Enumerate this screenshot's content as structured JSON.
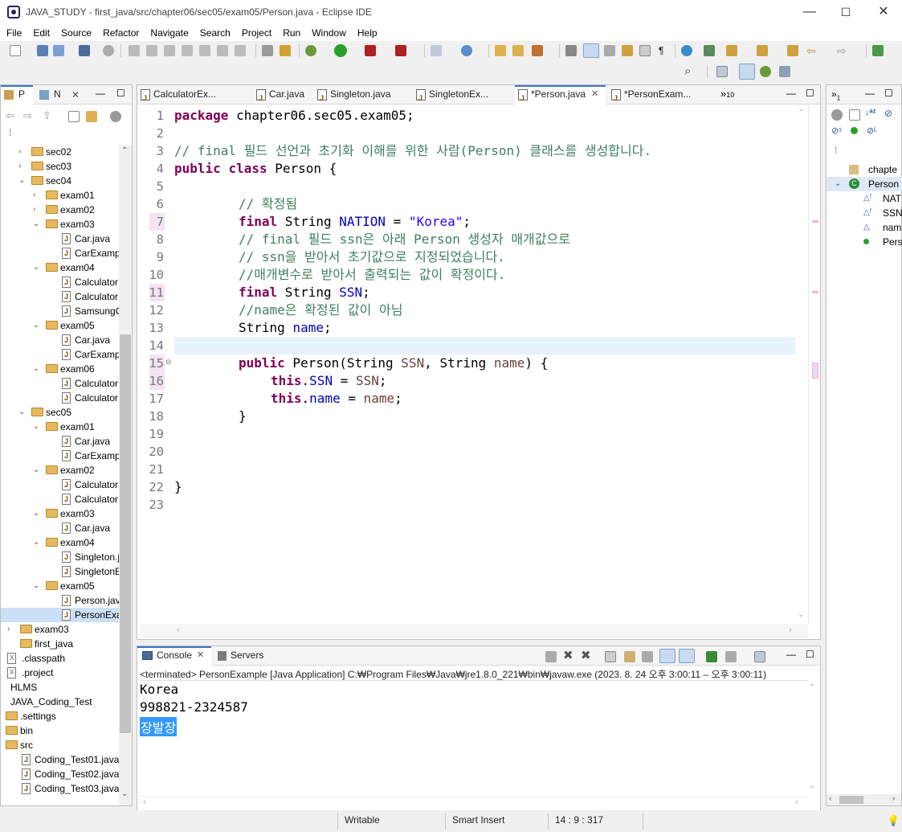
{
  "window": {
    "title": "JAVA_STUDY - first_java/src/chapter06/sec05/exam05/Person.java - Eclipse IDE",
    "min": "—",
    "max": "☐",
    "close": "✕"
  },
  "menu": [
    "File",
    "Edit",
    "Source",
    "Refactor",
    "Navigate",
    "Search",
    "Project",
    "Run",
    "Window",
    "Help"
  ],
  "left_panel": {
    "tabs": [
      "P",
      "N"
    ],
    "tree": [
      {
        "label": "sec02",
        "type": "folder"
      },
      {
        "label": "sec03",
        "type": "folder"
      },
      {
        "label": "sec04",
        "type": "folder"
      },
      {
        "label": "exam01",
        "type": "folder"
      },
      {
        "label": "exam02",
        "type": "folder"
      },
      {
        "label": "exam03",
        "type": "folder"
      },
      {
        "label": "Car.java",
        "type": "java"
      },
      {
        "label": "CarExamp",
        "type": "java"
      },
      {
        "label": "exam04",
        "type": "folder"
      },
      {
        "label": "Calculator",
        "type": "java"
      },
      {
        "label": "Calculator",
        "type": "java"
      },
      {
        "label": "SamsungC",
        "type": "java"
      },
      {
        "label": "exam05",
        "type": "folder"
      },
      {
        "label": "Car.java",
        "type": "java"
      },
      {
        "label": "CarExamp",
        "type": "java"
      },
      {
        "label": "exam06",
        "type": "folder"
      },
      {
        "label": "Calculator",
        "type": "java"
      },
      {
        "label": "Calculator",
        "type": "java"
      },
      {
        "label": "sec05",
        "type": "folder"
      },
      {
        "label": "exam01",
        "type": "folder"
      },
      {
        "label": "Car.java",
        "type": "java"
      },
      {
        "label": "CarExamp",
        "type": "java"
      },
      {
        "label": "exam02",
        "type": "folder"
      },
      {
        "label": "Calculator",
        "type": "java"
      },
      {
        "label": "Calculator",
        "type": "java"
      },
      {
        "label": "exam03",
        "type": "folder"
      },
      {
        "label": "Car.java",
        "type": "java"
      },
      {
        "label": "exam04",
        "type": "folder"
      },
      {
        "label": "Singleton.j",
        "type": "java"
      },
      {
        "label": "SingletonE",
        "type": "java"
      },
      {
        "label": "exam05",
        "type": "folder"
      },
      {
        "label": "Person.java",
        "type": "java"
      },
      {
        "label": "PersonExa",
        "type": "java"
      },
      {
        "label": "exam03",
        "type": "folder"
      },
      {
        "label": "first_java",
        "type": "folder"
      },
      {
        "label": ".classpath",
        "type": "xml"
      },
      {
        "label": ".project",
        "type": "xml"
      },
      {
        "label": "HLMS",
        "type": "project"
      },
      {
        "label": "JAVA_Coding_Test",
        "type": "project"
      },
      {
        "label": ".settings",
        "type": "folder"
      },
      {
        "label": "bin",
        "type": "folder"
      },
      {
        "label": "src",
        "type": "folder"
      },
      {
        "label": "Coding_Test01.java",
        "type": "java"
      },
      {
        "label": "Coding_Test02.java",
        "type": "java"
      },
      {
        "label": "Coding_Test03.java",
        "type": "java"
      }
    ]
  },
  "editor": {
    "tabs": [
      {
        "label": "CalculatorEx..."
      },
      {
        "label": "Car.java"
      },
      {
        "label": "Singleton.java"
      },
      {
        "label": "SingletonEx..."
      },
      {
        "label": "*Person.java"
      },
      {
        "label": "*PersonExam..."
      }
    ],
    "overflow": "»",
    "overflow_count": "10",
    "line_numbers": [
      "1",
      "2",
      "3",
      "4",
      "5",
      "6",
      "7",
      "8",
      "9",
      "10",
      "11",
      "12",
      "13",
      "14",
      "15",
      "16",
      "17",
      "18",
      "19",
      "20",
      "21",
      "22",
      "23"
    ],
    "code": {
      "l1_kw": "package",
      "l1_rest": " chapter06.sec05.exam05;",
      "l3_cm": "// final 필드 선언과 초기화 이해를 위한 사람(Person) 클래스를 생성합니다.",
      "l4_kw1": "public",
      "l4_kw2": "class",
      "l4_rest": " Person {",
      "l6_cm": "// 확정됨",
      "l7_kw": "final",
      "l7_type": " String ",
      "l7_field": "NATION",
      "l7_eq": " = ",
      "l7_str": "\"Korea\"",
      "l7_end": ";",
      "l8_cm": "// final 필드 ssn은 아래 Person 생성자 매개값으로",
      "l9_cm": "// ssn을 받아서 초기값으로 지정되었습니다.",
      "l10_cm": "//매개변수로 받아서 출력되는 값이 확정이다.",
      "l11_kw": "final",
      "l11_type": " String ",
      "l11_field": "SSN",
      "l11_end": ";",
      "l12_cm": "//name은 확정된 값이 아님",
      "l13_type": "String ",
      "l13_field": "name",
      "l13_end": ";",
      "l15_kw": "public",
      "l15_a": " Person(String ",
      "l15_p1": "SSN",
      "l15_b": ", String ",
      "l15_p2": "name",
      "l15_c": ") {",
      "l16_kw": "this",
      "l16_dot": ".",
      "l16_field": "SSN",
      "l16_eq": " = ",
      "l16_p": "SSN",
      "l16_end": ";",
      "l17_kw": "this",
      "l17_dot": ".",
      "l17_field": "name",
      "l17_eq": " = ",
      "l17_p": "name",
      "l17_end": ";",
      "l18": "}",
      "l22": "}"
    }
  },
  "outline": {
    "items": [
      "chapte",
      "Person",
      "NAT",
      "SSN",
      "nam",
      "Pers"
    ],
    "tab_suffix": "1"
  },
  "console": {
    "tabs": [
      "Console",
      "Servers"
    ],
    "status": "<terminated> PersonExample [Java Application] C:₩Program Files₩Java₩jre1.8.0_221₩bin₩javaw.exe  (2023. 8. 24 오후 3:00:11 – 오후 3:00:11)",
    "output": [
      "Korea",
      "998821-2324587",
      "장발장"
    ]
  },
  "statusbar": {
    "writable": "Writable",
    "insert": "Smart Insert",
    "position": "14 : 9 : 317"
  },
  "colors": {
    "keyword": "#7f0055",
    "comment": "#3f7f5f",
    "field": "#0000c0",
    "string": "#2a00ff",
    "selection": "#3399ff"
  }
}
